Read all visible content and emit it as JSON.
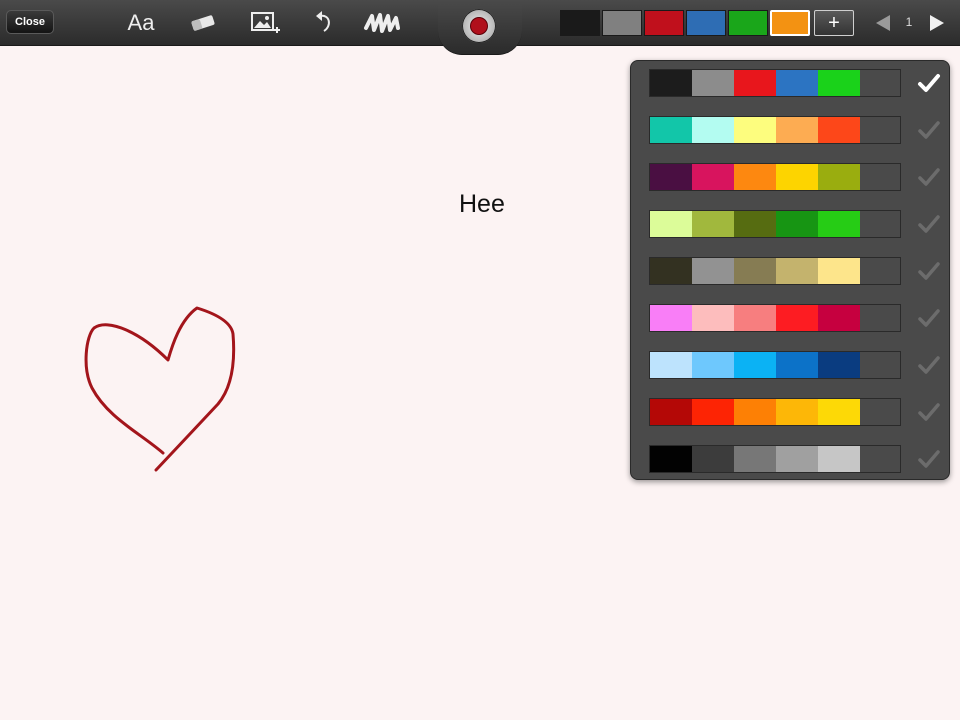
{
  "toolbar": {
    "close_label": "Close",
    "text_tool_label": "Aa",
    "icons": [
      "text-tool",
      "eraser-icon",
      "insert-image-icon",
      "undo-icon",
      "clear-scribble-icon"
    ],
    "record_button_color": "#b0101c",
    "color_swatches": [
      "#1a1a1a",
      "#808080",
      "#c0101c",
      "#2e6db4",
      "#1aa61a",
      "#f39212"
    ],
    "selected_swatch_index": 5,
    "add_swatch_label": "+",
    "page_number": "1"
  },
  "canvas": {
    "text": "Hee",
    "stroke_color": "#a3151b"
  },
  "palette": {
    "selected_row_index": 0,
    "rows": [
      [
        "#1c1c1c",
        "#8c8c8c",
        "#e8161c",
        "#2c74c2",
        "#1ad21a",
        "#f99a12"
      ],
      [
        "#12c6a9",
        "#b3fcf1",
        "#fdfd7e",
        "#fdac52",
        "#fd4719",
        "#e6e6cb"
      ],
      [
        "#4a0f42",
        "#d8145e",
        "#fd8810",
        "#fdd400",
        "#9aad0f",
        "#db8e09"
      ],
      [
        "#dcfc99",
        "#a1b83d",
        "#566c11",
        "#179513",
        "#26cc15",
        "#8dea74"
      ],
      [
        "#333121",
        "#929292",
        "#867c53",
        "#c4b36d",
        "#fde58b",
        "#849d5c"
      ],
      [
        "#f97ef7",
        "#fdbdbd",
        "#f77e7f",
        "#fd1c22",
        "#c6003f",
        "#760032"
      ],
      [
        "#bde3fd",
        "#6ec8fd",
        "#0bb2f4",
        "#0c72c8",
        "#0a3c80",
        "#8188d6"
      ],
      [
        "#b40806",
        "#fd2404",
        "#fd8005",
        "#fdb707",
        "#fdd906",
        "#fdfd7a"
      ],
      [
        "#020202",
        "#3c3c3c",
        "#777777",
        "#a0a0a0",
        "#c6c6c6",
        "#f0f0f0"
      ]
    ]
  }
}
